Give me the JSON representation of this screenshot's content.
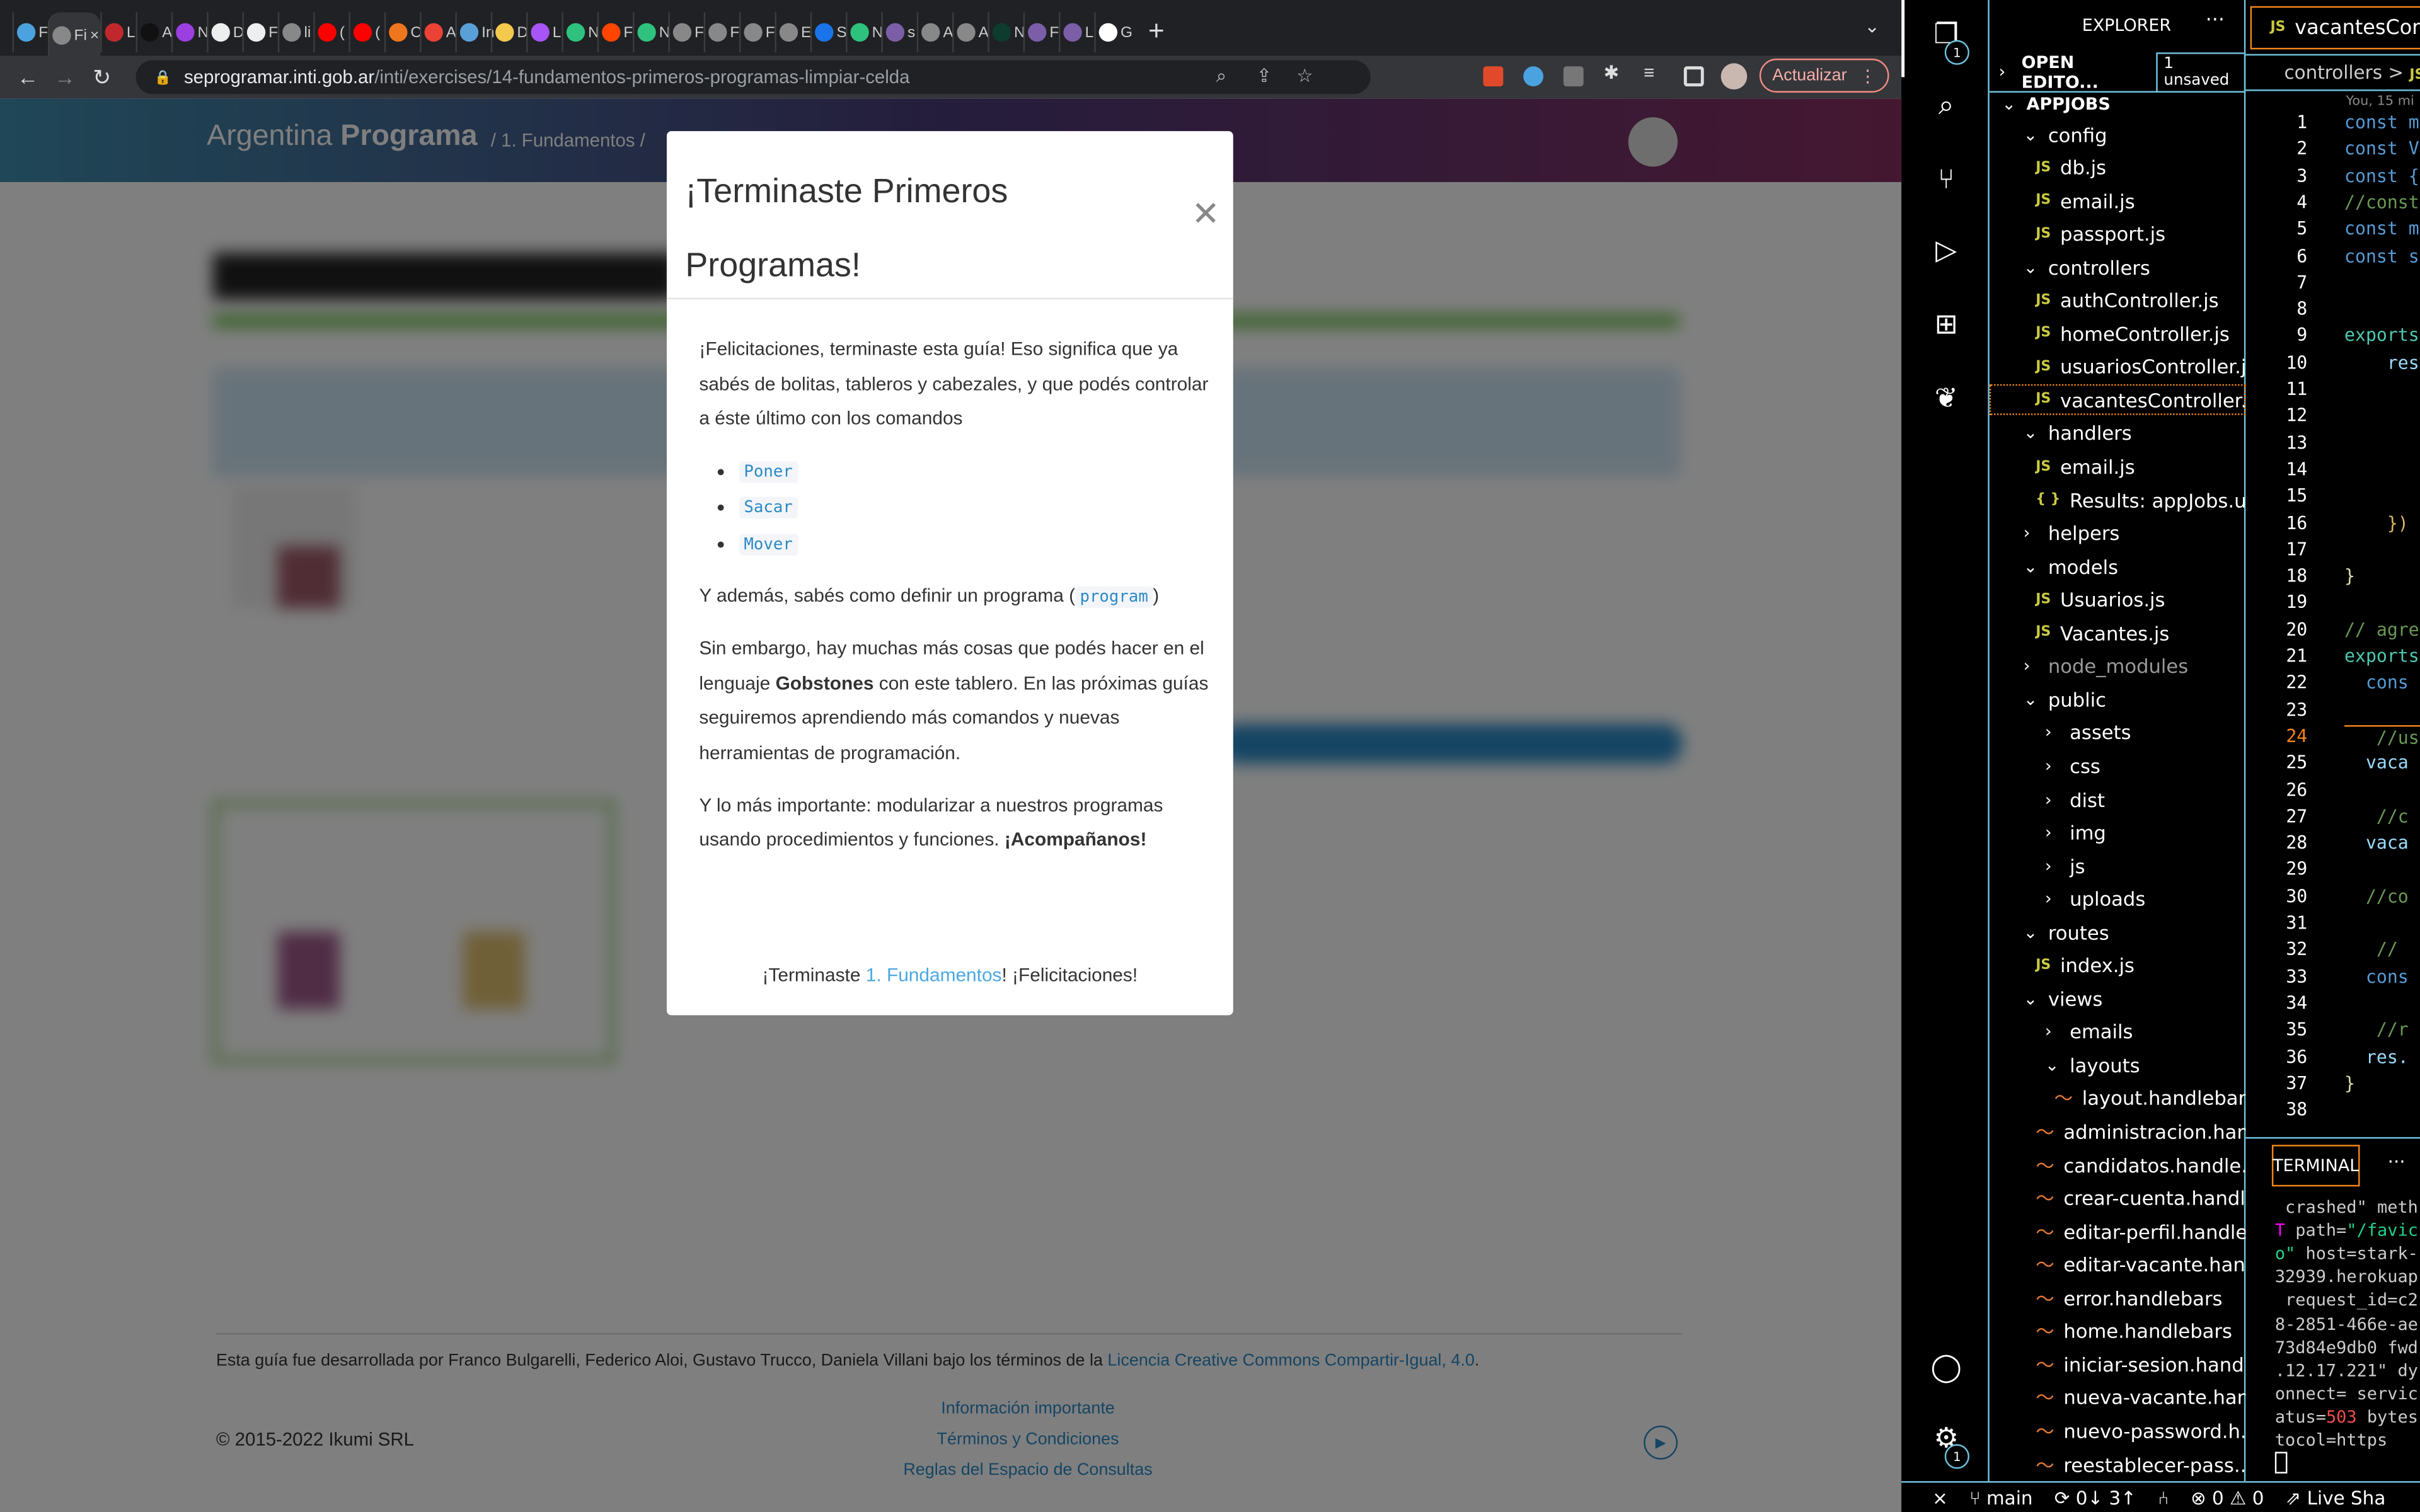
{
  "browser": {
    "tabs": [
      {
        "t": "F",
        "c": "#4aa3df"
      },
      {
        "t": "Fi",
        "c": "#888",
        "active": true
      },
      {
        "t": "L",
        "c": "#c0282d"
      },
      {
        "t": "A",
        "c": "#111"
      },
      {
        "t": "N",
        "c": "#9b3fe0"
      },
      {
        "t": "D",
        "c": "#eee"
      },
      {
        "t": "F",
        "c": "#eee"
      },
      {
        "t": "li",
        "c": "#888"
      },
      {
        "t": "(",
        "c": "#f00"
      },
      {
        "t": "(",
        "c": "#f00"
      },
      {
        "t": "C",
        "c": "#f0761e"
      },
      {
        "t": "A",
        "c": "#ea4335"
      },
      {
        "t": "In",
        "c": "#5aa0d8"
      },
      {
        "t": "D",
        "c": "#f2c94c"
      },
      {
        "t": "L",
        "c": "#a855f7"
      },
      {
        "t": "N",
        "c": "#2ec27e"
      },
      {
        "t": "F",
        "c": "#ff4500"
      },
      {
        "t": "N",
        "c": "#2ec27e"
      },
      {
        "t": "F",
        "c": "#888"
      },
      {
        "t": "F",
        "c": "#888"
      },
      {
        "t": "F",
        "c": "#888"
      },
      {
        "t": "E",
        "c": "#888"
      },
      {
        "t": "S",
        "c": "#1a73e8"
      },
      {
        "t": "N",
        "c": "#2ec27e"
      },
      {
        "t": "s",
        "c": "#7b5ea7"
      },
      {
        "t": "A",
        "c": "#888"
      },
      {
        "t": "A",
        "c": "#888"
      },
      {
        "t": "N",
        "c": "#0d3b2e"
      },
      {
        "t": "F",
        "c": "#7b5ea7"
      },
      {
        "t": "L",
        "c": "#7b5ea7"
      },
      {
        "t": "G",
        "c": "#fff"
      }
    ],
    "new_tab": "+",
    "url_domain": "seprogramar.inti.gob.ar",
    "url_path": "/inti/exercises/14-fundamentos-primeros-programas-limpiar-celda",
    "update_label": "Actualizar"
  },
  "site": {
    "brand_light": "Argentina ",
    "brand_bold": "Programa",
    "breadcrumb": "/  1. Fundamentos  /",
    "footer": {
      "credit": "Esta guía fue desarrollada por Franco Bulgarelli, Federico Aloi, Gustavo Trucco, Daniela Villani bajo los términos de la ",
      "license_link": "Licencia Creative Commons Compartir-Igual, 4.0",
      "credit_end": ".",
      "copyright": "© 2015-2022 Ikumi SRL",
      "links": [
        "Información importante",
        "Términos y Condiciones",
        "Reglas del Espacio de Consultas"
      ]
    }
  },
  "modal": {
    "title": "¡Terminaste Primeros Programas!",
    "p1": "¡Felicitaciones, terminaste esta guía! Eso significa que ya sabés de bolitas, tableros y cabezales, y que podés controlar a éste último con los comandos",
    "commands": [
      "Poner",
      "Sacar",
      "Mover"
    ],
    "p2_pre": "Y además, sabés como definir un programa (",
    "p2_code": "program",
    "p2_post": ")",
    "p3_pre": "Sin embargo, hay muchas más cosas que podés hacer en el lenguaje ",
    "p3_bold": "Gobstones",
    "p3_post": " con este tablero. En las próximas guías seguiremos aprendiendo más comandos y nuevas herramientas de programación.",
    "p4_pre": "Y lo más importante: modularizar a nuestros programas usando procedimientos y funciones. ",
    "p4_bold": "¡Acompañanos!",
    "foot_pre": "¡Terminaste ",
    "foot_link": "1. Fundamentos",
    "foot_post": "! ¡Felicitaciones!"
  },
  "vscode": {
    "explorer_title": "EXPLORER",
    "open_editors": "OPEN EDITO...",
    "unsaved": "1 unsaved",
    "root": "APPJOBS",
    "badge_explorer": "1",
    "badge_settings": "1",
    "tree": [
      {
        "label": "config",
        "kind": "folder-open",
        "depth": 1
      },
      {
        "label": "db.js",
        "kind": "js",
        "depth": 2
      },
      {
        "label": "email.js",
        "kind": "js",
        "depth": 2
      },
      {
        "label": "passport.js",
        "kind": "js",
        "depth": 2
      },
      {
        "label": "controllers",
        "kind": "folder-open",
        "depth": 1
      },
      {
        "label": "authController.js",
        "kind": "js",
        "depth": 2
      },
      {
        "label": "homeController.js",
        "kind": "js",
        "depth": 2
      },
      {
        "label": "usuariosController.js",
        "kind": "js",
        "depth": 2
      },
      {
        "label": "vacantesController.js",
        "kind": "js",
        "depth": 2,
        "selected": true
      },
      {
        "label": "handlers",
        "kind": "folder-open",
        "depth": 1
      },
      {
        "label": "email.js",
        "kind": "js",
        "depth": 2
      },
      {
        "label": "Results: appJobs.u...",
        "kind": "json",
        "depth": 2
      },
      {
        "label": "helpers",
        "kind": "folder",
        "depth": 1
      },
      {
        "label": "models",
        "kind": "folder-open",
        "depth": 1
      },
      {
        "label": "Usuarios.js",
        "kind": "js",
        "depth": 2
      },
      {
        "label": "Vacantes.js",
        "kind": "js",
        "depth": 2
      },
      {
        "label": "node_modules",
        "kind": "folder",
        "depth": 1,
        "dim": true
      },
      {
        "label": "public",
        "kind": "folder-open",
        "depth": 1
      },
      {
        "label": "assets",
        "kind": "folder",
        "depth": 2
      },
      {
        "label": "css",
        "kind": "folder",
        "depth": 2
      },
      {
        "label": "dist",
        "kind": "folder",
        "depth": 2
      },
      {
        "label": "img",
        "kind": "folder",
        "depth": 2
      },
      {
        "label": "js",
        "kind": "folder",
        "depth": 2
      },
      {
        "label": "uploads",
        "kind": "folder",
        "depth": 2
      },
      {
        "label": "routes",
        "kind": "folder-open",
        "depth": 1
      },
      {
        "label": "index.js",
        "kind": "js",
        "depth": 2
      },
      {
        "label": "views",
        "kind": "folder-open",
        "depth": 1
      },
      {
        "label": "emails",
        "kind": "folder",
        "depth": 2
      },
      {
        "label": "layouts",
        "kind": "folder-open",
        "depth": 2
      },
      {
        "label": "layout.handlebars",
        "kind": "hbs",
        "depth": 3
      },
      {
        "label": "administracion.han...",
        "kind": "hbs",
        "depth": 2
      },
      {
        "label": "candidatos.handle...",
        "kind": "hbs",
        "depth": 2
      },
      {
        "label": "crear-cuenta.handl...",
        "kind": "hbs",
        "depth": 2
      },
      {
        "label": "editar-perfil.handle...",
        "kind": "hbs",
        "depth": 2
      },
      {
        "label": "editar-vacante.han...",
        "kind": "hbs",
        "depth": 2
      },
      {
        "label": "error.handlebars",
        "kind": "hbs",
        "depth": 2
      },
      {
        "label": "home.handlebars",
        "kind": "hbs",
        "depth": 2
      },
      {
        "label": "iniciar-sesion.hand...",
        "kind": "hbs",
        "depth": 2
      },
      {
        "label": "nueva-vacante.han...",
        "kind": "hbs",
        "depth": 2
      },
      {
        "label": "nuevo-password.h...",
        "kind": "hbs",
        "depth": 2
      },
      {
        "label": "reestablecer-pass...",
        "kind": "hbs",
        "depth": 2
      }
    ],
    "editor_tab": "vacantesCont",
    "breadcrumb": "controllers  >",
    "blame": "You, 15 mi",
    "lines": [
      {
        "n": "1",
        "code": "const m",
        "c": "#569cd6"
      },
      {
        "n": "2",
        "code": "const V",
        "c": "#569cd6"
      },
      {
        "n": "3",
        "code": "const {",
        "c": "#569cd6"
      },
      {
        "n": "4",
        "code": "//const",
        "c": "#6a9955"
      },
      {
        "n": "5",
        "code": "const m",
        "c": "#569cd6"
      },
      {
        "n": "6",
        "code": "const s",
        "c": "#569cd6"
      },
      {
        "n": "7",
        "code": ""
      },
      {
        "n": "8",
        "code": ""
      },
      {
        "n": "9",
        "code": "exports",
        "c": "#4ec9b0"
      },
      {
        "n": "10",
        "code": "    res",
        "c": "#9cdcfe"
      },
      {
        "n": "11",
        "code": ""
      },
      {
        "n": "12",
        "code": ""
      },
      {
        "n": "13",
        "code": ""
      },
      {
        "n": "14",
        "code": ""
      },
      {
        "n": "15",
        "code": ""
      },
      {
        "n": "16",
        "code": "    })",
        "c": "#dcb862"
      },
      {
        "n": "17",
        "code": ""
      },
      {
        "n": "18",
        "code": "}",
        "c": "#dcdcaa"
      },
      {
        "n": "19",
        "code": ""
      },
      {
        "n": "20",
        "code": "// agre",
        "c": "#6a9955"
      },
      {
        "n": "21",
        "code": "exports",
        "c": "#4ec9b0"
      },
      {
        "n": "22",
        "code": "  cons",
        "c": "#569cd6"
      },
      {
        "n": "23",
        "code": ""
      },
      {
        "n": "24",
        "code": "   //us",
        "c": "#6a9955",
        "current": true
      },
      {
        "n": "25",
        "code": "  vaca",
        "c": "#9cdcfe"
      },
      {
        "n": "26",
        "code": ""
      },
      {
        "n": "27",
        "code": "   //c",
        "c": "#6a9955"
      },
      {
        "n": "28",
        "code": "  vaca",
        "c": "#9cdcfe"
      },
      {
        "n": "29",
        "code": ""
      },
      {
        "n": "30",
        "code": "  //co",
        "c": "#6a9955"
      },
      {
        "n": "31",
        "code": ""
      },
      {
        "n": "32",
        "code": "   //",
        "c": "#6a9955"
      },
      {
        "n": "33",
        "code": "  cons",
        "c": "#569cd6"
      },
      {
        "n": "34",
        "code": ""
      },
      {
        "n": "35",
        "code": "   //r",
        "c": "#6a9955"
      },
      {
        "n": "36",
        "code": "  res.",
        "c": "#9cdcfe"
      },
      {
        "n": "37",
        "code": "}",
        "c": "#dcdcaa"
      },
      {
        "n": "38",
        "code": ""
      }
    ],
    "terminal_tab": "TERMINAL",
    "terminal": [
      [
        {
          "t": " crashed\" meth",
          "c": "#ccc"
        }
      ],
      [
        {
          "t": "T",
          "c": "#ff00ff"
        },
        {
          "t": " path=",
          "c": "#ccc"
        },
        {
          "t": "\"/favic",
          "c": "#23d18b"
        }
      ],
      [
        {
          "t": "o\"",
          "c": "#23d18b"
        },
        {
          "t": " host=stark-",
          "c": "#ccc"
        }
      ],
      [
        {
          "t": "32939.herokuap",
          "c": "#ccc"
        }
      ],
      [
        {
          "t": " request_id=c2",
          "c": "#ccc"
        }
      ],
      [
        {
          "t": "8-2851-466e-ae",
          "c": "#ccc"
        }
      ],
      [
        {
          "t": "73d84e9db0 fwd",
          "c": "#ccc"
        }
      ],
      [
        {
          "t": ".12.17.221\" dy",
          "c": "#ccc"
        }
      ],
      [
        {
          "t": "onnect= servic",
          "c": "#ccc"
        }
      ],
      [
        {
          "t": "atus=",
          "c": "#ccc"
        },
        {
          "t": "503",
          "c": "#f14c4c"
        },
        {
          "t": " bytes",
          "c": "#ccc"
        }
      ],
      [
        {
          "t": "tocol=https",
          "c": "#ccc"
        }
      ]
    ],
    "status": {
      "branch": "main",
      "sync": "0↓ 3↑",
      "errors": "0",
      "warnings": "0",
      "liveshare": "Live Sha"
    }
  }
}
